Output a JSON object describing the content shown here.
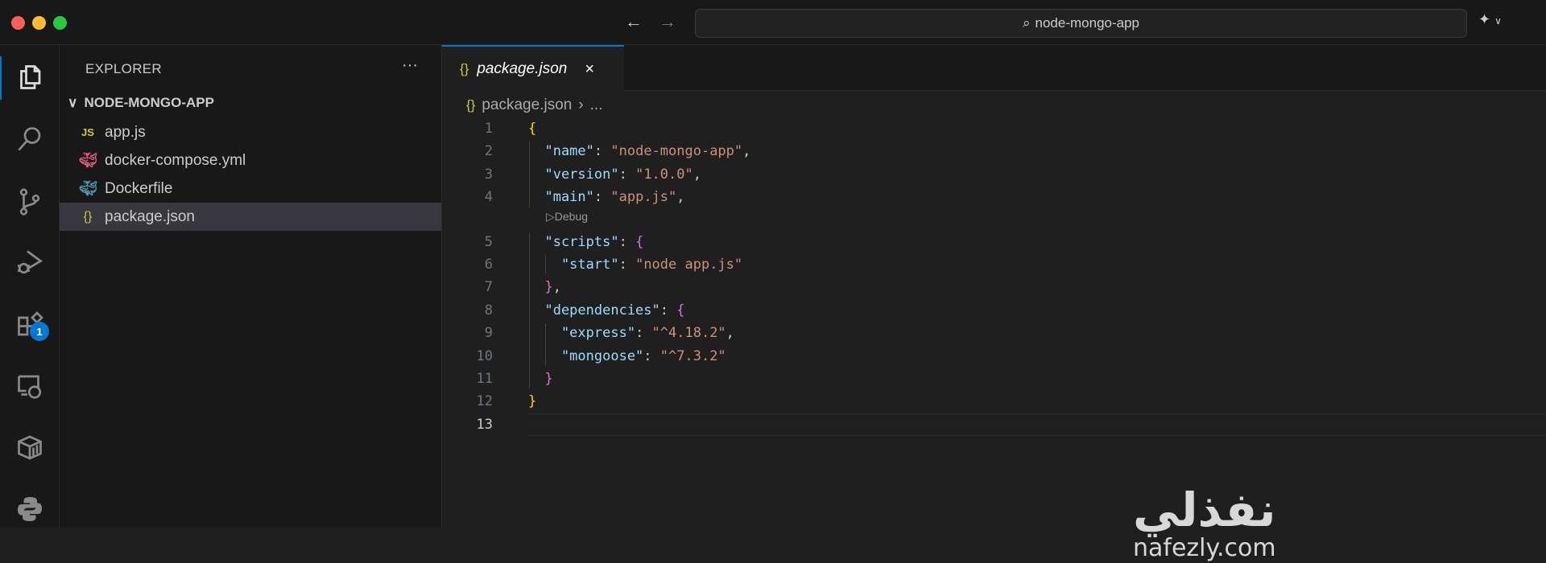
{
  "titlebar": {
    "search_text": "node-mongo-app",
    "back_icon": "arrow-left-icon",
    "forward_icon": "arrow-right-icon"
  },
  "colors": {
    "accent": "#0078d4",
    "key": "#9cdcfe",
    "string": "#ce9178",
    "brace1": "#ffd700",
    "brace2": "#da70d6"
  },
  "activity": {
    "extensions_badge": "1"
  },
  "sidebar": {
    "title": "EXPLORER",
    "more": "···",
    "root": "NODE-MONGO-APP",
    "files": [
      {
        "name": "app.js",
        "icon": "JS"
      },
      {
        "name": "docker-compose.yml",
        "icon": "docker"
      },
      {
        "name": "Dockerfile",
        "icon": "docker"
      },
      {
        "name": "package.json",
        "icon": "{}"
      }
    ]
  },
  "editor": {
    "tab": {
      "icon": "{}",
      "label": "package.json",
      "close": "×"
    },
    "breadcrumb": {
      "icon": "{}",
      "file": "package.json",
      "sep": "›",
      "more": "..."
    },
    "codelens": "▷Debug",
    "lines": [
      [
        [
          "b1",
          "{"
        ]
      ],
      [
        [
          "k",
          "  \"name\""
        ],
        [
          "p",
          ": "
        ],
        [
          "s",
          "\"node-mongo-app\""
        ],
        [
          "p",
          ","
        ]
      ],
      [
        [
          "k",
          "  \"version\""
        ],
        [
          "p",
          ": "
        ],
        [
          "s",
          "\"1.0.0\""
        ],
        [
          "p",
          ","
        ]
      ],
      [
        [
          "k",
          "  \"main\""
        ],
        [
          "p",
          ": "
        ],
        [
          "s",
          "\"app.js\""
        ],
        [
          "p",
          ","
        ]
      ],
      [
        [
          "k",
          "  \"scripts\""
        ],
        [
          "p",
          ": "
        ],
        [
          "b2",
          "{"
        ]
      ],
      [
        [
          "k",
          "    \"start\""
        ],
        [
          "p",
          ": "
        ],
        [
          "s",
          "\"node app.js\""
        ]
      ],
      [
        [
          "b2",
          "  }"
        ],
        [
          "p",
          ","
        ]
      ],
      [
        [
          "k",
          "  \"dependencies\""
        ],
        [
          "p",
          ": "
        ],
        [
          "b2",
          "{"
        ]
      ],
      [
        [
          "k",
          "    \"express\""
        ],
        [
          "p",
          ": "
        ],
        [
          "s",
          "\"^4.18.2\""
        ],
        [
          "p",
          ","
        ]
      ],
      [
        [
          "k",
          "    \"mongoose\""
        ],
        [
          "p",
          ": "
        ],
        [
          "s",
          "\"^7.3.2\""
        ]
      ],
      [
        [
          "b2",
          "  }"
        ]
      ],
      [
        [
          "b1",
          "}"
        ]
      ],
      []
    ]
  },
  "watermark": {
    "arabic": "نفذلي",
    "latin": "nafezly.com"
  }
}
